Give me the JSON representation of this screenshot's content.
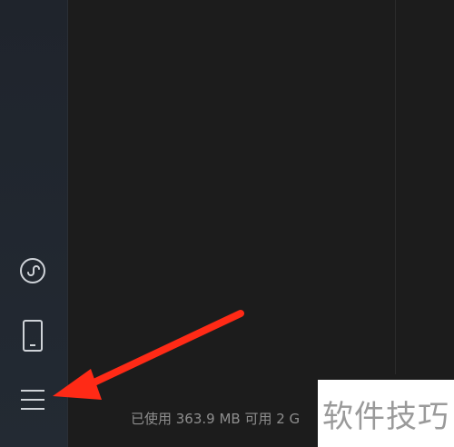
{
  "sidebar": {
    "items": [
      {
        "name": "mini-program-icon"
      },
      {
        "name": "phone-icon"
      },
      {
        "name": "menu-icon"
      }
    ]
  },
  "status_bar": {
    "memory_text": "已使用 363.9 MB 可用 2 G"
  },
  "watermark": {
    "text": "软件技巧"
  },
  "colors": {
    "sidebar_bg": "#222831",
    "main_bg": "#1c1c1c",
    "icon_stroke": "#cfd3d8",
    "arrow": "#ff2a16"
  }
}
